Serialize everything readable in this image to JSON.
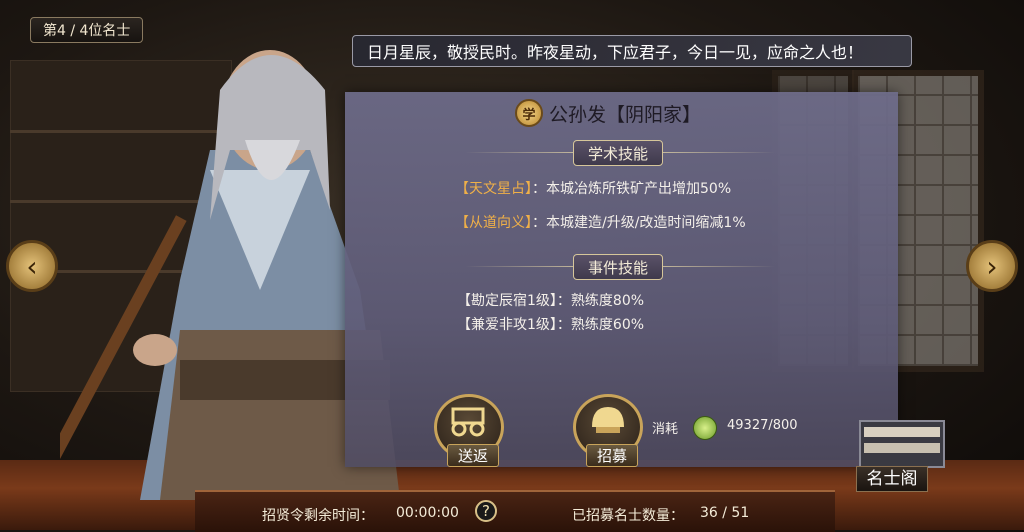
{
  "header": {
    "counter": "第4 / 4位名士"
  },
  "speech": "日月星辰，敬授民时。昨夜星动，下应君子，今日一见，应命之人也！",
  "panel": {
    "seal_char": "学",
    "title": "公孙发【阴阳家】",
    "academic_title": "学术技能",
    "academic_skills": [
      {
        "name": "【天文星占】",
        "desc": "：本城冶炼所铁矿产出增加50%"
      },
      {
        "name": "【从道向义】",
        "desc": "：本城建造/升级/改造时间缩减1%"
      }
    ],
    "event_title": "事件技能",
    "event_skills": [
      "【勘定辰宿1级】：熟练度80%",
      "【兼爱非攻1级】：熟练度60%"
    ]
  },
  "actions": {
    "send_back": "送返",
    "recruit": "招募",
    "cost_label": "消耗",
    "cost_value": "49327/800"
  },
  "hall": {
    "label": "名士阁"
  },
  "footer": {
    "timer_label": "招贤令剩余时间：",
    "timer_value": "00:00:00",
    "help": "?",
    "count_label": "已招募名士数量：",
    "count_value": "36 / 51"
  }
}
